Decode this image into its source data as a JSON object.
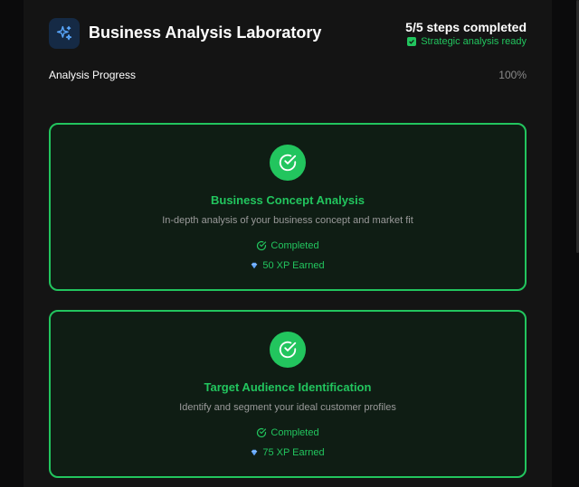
{
  "header": {
    "title": "Business Analysis Laboratory",
    "steps_summary": "5/5 steps completed",
    "status_text": "Strategic analysis ready",
    "logo_icon": "sparkles-icon"
  },
  "progress": {
    "label": "Analysis Progress",
    "value_text": "100%",
    "value": 100
  },
  "colors": {
    "accent": "#22c55e",
    "logo_bg": "#152a45",
    "card_bg": "#0f1d14",
    "panel_bg": "#141414"
  },
  "cards": [
    {
      "title": "Business Concept Analysis",
      "description": "In-depth analysis of your business concept and market fit",
      "status": "Completed",
      "xp": "50 XP Earned"
    },
    {
      "title": "Target Audience Identification",
      "description": "Identify and segment your ideal customer profiles",
      "status": "Completed",
      "xp": "75 XP Earned"
    }
  ]
}
